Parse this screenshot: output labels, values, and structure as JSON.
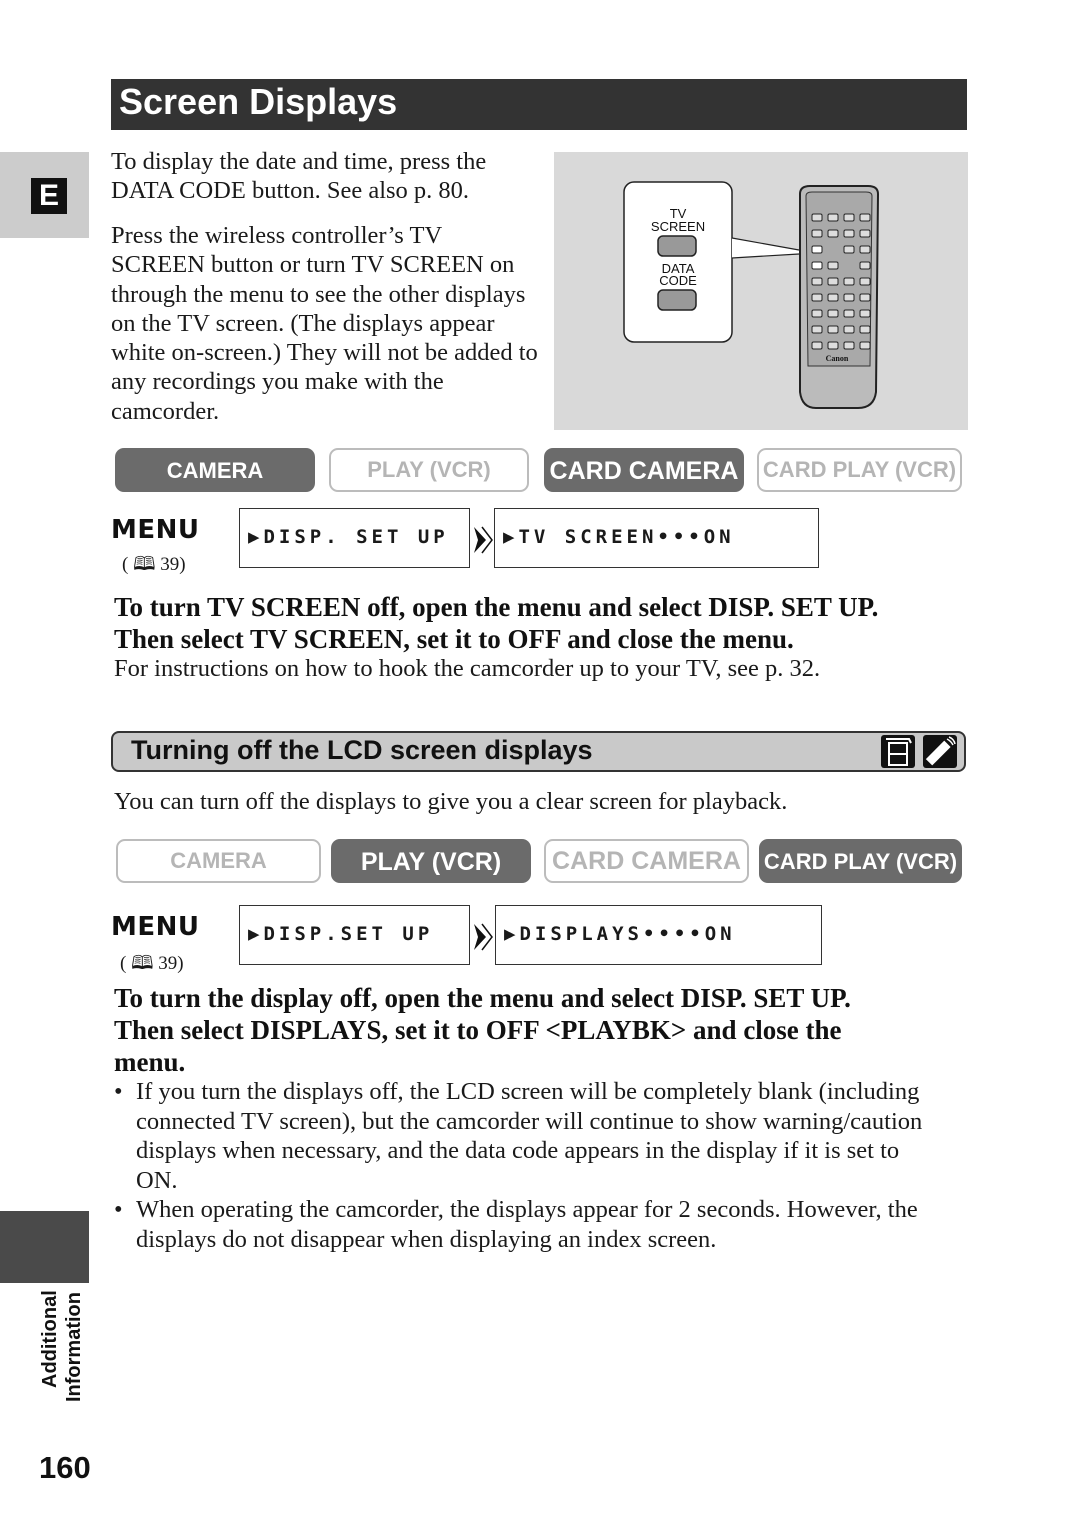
{
  "page": {
    "title": "Screen Displays",
    "language_tab": "E",
    "side_label_line1": "Additional",
    "side_label_line2": "Information",
    "page_number": "160"
  },
  "intro": {
    "paragraph1": "To display the date and time, press the DATA CODE button. See also p. 80.",
    "paragraph2": "Press the wireless controller’s TV SCREEN button or turn TV SCREEN on through the menu to see the other displays on the TV screen. (The displays appear white on-screen.) They will not be added to any recordings you make with the camcorder."
  },
  "illustration": {
    "button1_label_line1": "TV",
    "button1_label_line2": "SCREEN",
    "button2_label_line1": "DATA",
    "button2_label_line2": "CODE",
    "remote_brand": "Canon"
  },
  "section1": {
    "modes": [
      {
        "label": "CAMERA",
        "active": true
      },
      {
        "label": "PLAY (VCR)",
        "active": false
      },
      {
        "label": "CARD CAMERA",
        "active": true
      },
      {
        "label": "CARD PLAY (VCR)",
        "active": false
      }
    ],
    "menu_label": "MENU",
    "menu_ref": "39",
    "menu_step1": "▶DISP. SET UP",
    "menu_step2": "▶TV SCREEN•••ON",
    "instruction_bold": "To turn TV SCREEN off, open the menu and select DISP. SET UP. Then select TV SCREEN, set it to OFF and close the menu.",
    "instruction_note": "For instructions on how to hook the camcorder up to your TV, see p. 32."
  },
  "section2": {
    "heading": "Turning off the LCD screen displays",
    "icons": [
      "camcorder-icon",
      "wireless-controller-icon"
    ],
    "intro": "You can turn off the displays to give you a clear screen for playback.",
    "modes": [
      {
        "label": "CAMERA",
        "active": false
      },
      {
        "label": "PLAY (VCR)",
        "active": true
      },
      {
        "label": "CARD CAMERA",
        "active": false
      },
      {
        "label": "CARD PLAY (VCR)",
        "active": true
      }
    ],
    "menu_label": "MENU",
    "menu_ref": "39",
    "menu_step1": "▶DISP.SET UP",
    "menu_step2": "▶DISPLAYS••••ON",
    "instruction_bold": "To turn the display off, open the menu and select DISP. SET UP. Then select DISPLAYS, set it to OFF <PLAYBK> and close the menu.",
    "bullets": [
      "If you turn the displays off, the LCD screen will be completely blank (including connected TV screen), but the camcorder will continue to show warning/caution displays when necessary, and the data code appears in the display if it is set to ON.",
      "When operating the camcorder, the displays appear for 2 seconds. However, the displays do not disappear when displaying an index screen."
    ]
  }
}
